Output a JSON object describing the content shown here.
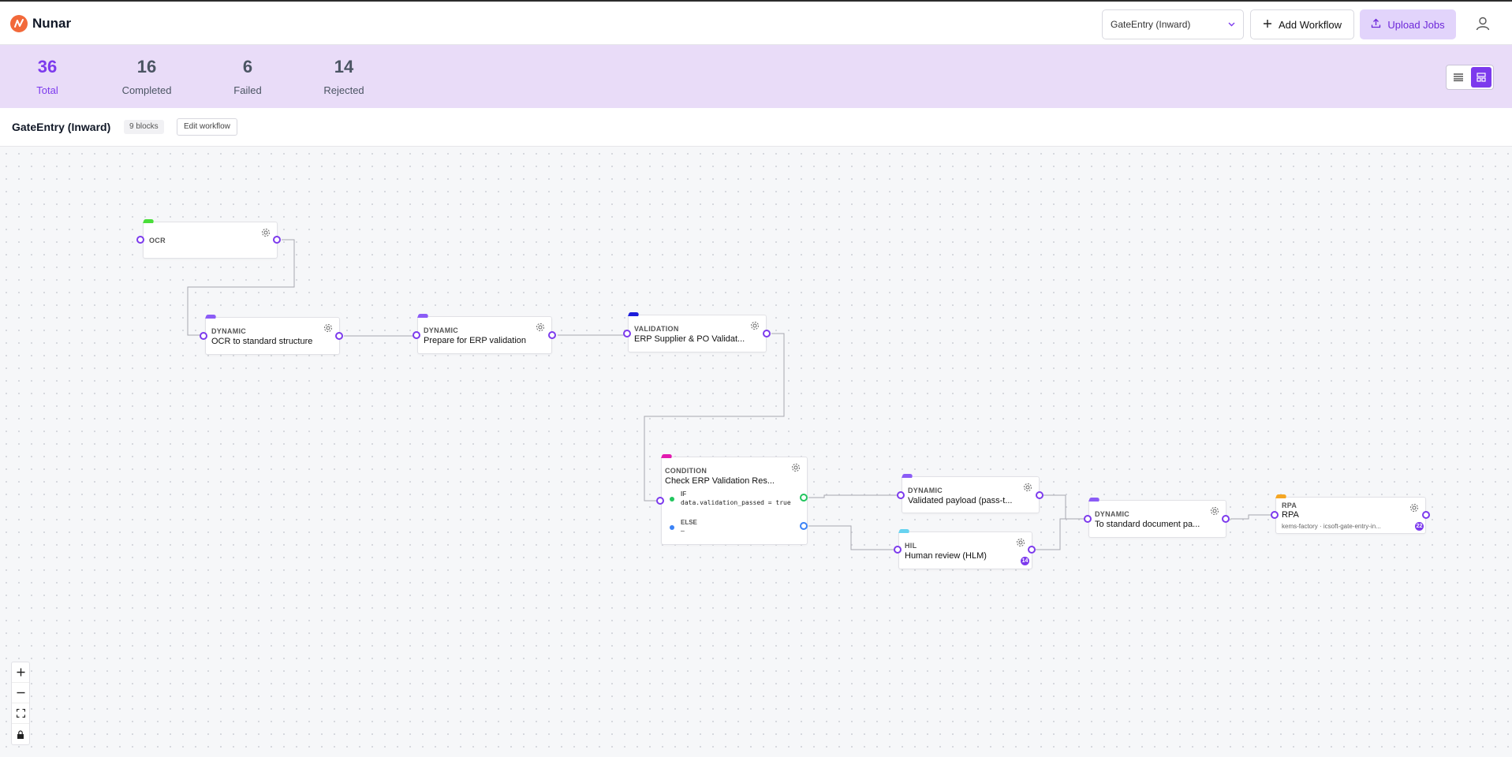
{
  "app": {
    "name": "Nunar",
    "brand_color": "#f2693a",
    "accent_color": "#7c3aed"
  },
  "header": {
    "workflow_select": {
      "value": "GateEntry (Inward)",
      "icon": "chevron-down-icon"
    },
    "add_workflow_label": "Add Workflow",
    "upload_jobs_label": "Upload Jobs",
    "profile_icon": "user-icon"
  },
  "stats": [
    {
      "value": "36",
      "label": "Total"
    },
    {
      "value": "16",
      "label": "Completed"
    },
    {
      "value": "6",
      "label": "Failed"
    },
    {
      "value": "14",
      "label": "Rejected"
    }
  ],
  "view_toggle": {
    "options": [
      "list-view-icon",
      "canvas-view-icon"
    ],
    "active": "canvas-view-icon"
  },
  "workflow": {
    "title": "GateEntry (Inward)",
    "blocks_badge": "9 blocks",
    "edit_label": "Edit workflow"
  },
  "nodes": {
    "ocr": {
      "kind": "OCR",
      "title": "",
      "tag_color": "#4ade3a"
    },
    "dyn1": {
      "kind": "DYNAMIC",
      "title": "OCR to standard structure",
      "tag_color": "#8b5cf6"
    },
    "dyn2": {
      "kind": "DYNAMIC",
      "title": "Prepare for ERP validation",
      "tag_color": "#8b5cf6"
    },
    "validation": {
      "kind": "VALIDATION",
      "title": "ERP Supplier & PO Validat...",
      "tag_color": "#1d1ddb"
    },
    "condition": {
      "kind": "CONDITION",
      "title": "Check ERP Validation Res...",
      "tag_color": "#e21bb0",
      "if_label": "IF",
      "if_expr": "data.validation_passed = true",
      "else_label": "ELSE",
      "else_expr": "–"
    },
    "dyn3": {
      "kind": "DYNAMIC",
      "title": "Validated payload (pass-t...",
      "tag_color": "#8b5cf6"
    },
    "hil": {
      "kind": "HIL",
      "title": "Human review (HLM)",
      "tag_color": "#67d3f0",
      "count": "14"
    },
    "dyn4": {
      "kind": "DYNAMIC",
      "title": "To standard document pa...",
      "tag_color": "#8b5cf6"
    },
    "rpa": {
      "kind": "RPA",
      "title": "RPA",
      "subtitle": "kems-factory · icsoft-gate-entry-in...",
      "tag_color": "#f5a623",
      "count": "22"
    }
  },
  "zoom_controls": [
    "zoom-in-icon",
    "zoom-out-icon",
    "fit-view-icon",
    "lock-icon"
  ]
}
